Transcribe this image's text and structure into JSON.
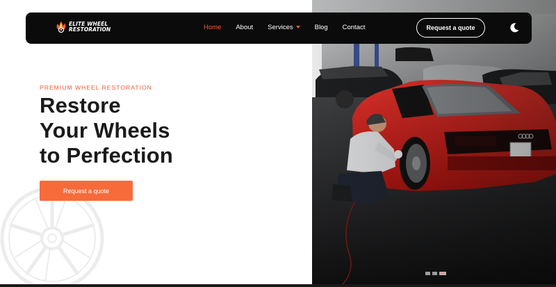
{
  "brand": {
    "line1": "ELITE WHEEL",
    "line2": "RESTORATION",
    "logo_icon": "flame-wheel-logo-icon"
  },
  "nav": {
    "items": [
      {
        "label": "Home",
        "active": true
      },
      {
        "label": "About",
        "active": false
      },
      {
        "label": "Services",
        "active": false,
        "has_dropdown": true
      },
      {
        "label": "Blog",
        "active": false
      },
      {
        "label": "Contact",
        "active": false
      }
    ],
    "quote_button": "Request a quote",
    "theme_toggle_icon": "moon-icon"
  },
  "hero": {
    "eyebrow": "PREMIUM WHEEL RESTORATION",
    "headline": [
      "Restore",
      "Your Wheels",
      "to Perfection"
    ],
    "cta": "Request a quote",
    "decor_icon": "wheel-rim-icon",
    "photo_alt_icon": "mechanic-polishing-red-sports-car-wheel-photo"
  },
  "slider": {
    "slide_count": 3,
    "active_index": 2
  },
  "colors": {
    "accent": "#f25c35",
    "button": "#f76b3b",
    "nav_bg": "#0b0b0b",
    "heading": "#1a1a1a",
    "car_red": "#d4201e"
  }
}
